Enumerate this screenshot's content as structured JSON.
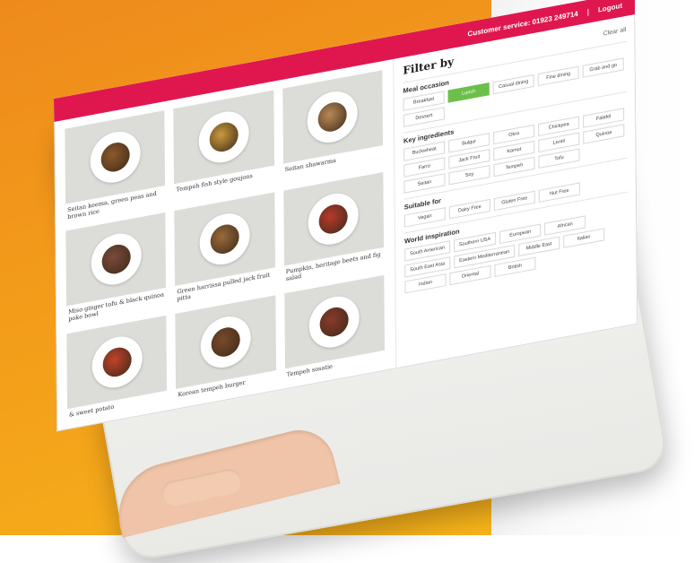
{
  "topbar": {
    "customer_service": "Customer service: 01923 249714",
    "separator": "|",
    "logout": "Logout"
  },
  "dishes": [
    {
      "caption": "Seitan keema, green peas and brown rice",
      "accent": "#8c5a2a"
    },
    {
      "caption": "Tempeh fish style goujons",
      "accent": "#c99a3c"
    },
    {
      "caption": "Seitan shawarma",
      "accent": "#b98a56"
    },
    {
      "caption": "Miso ginger tofu & black quinoa poke bowl",
      "accent": "#7a4a3a"
    },
    {
      "caption": "Green harrissa pulled jack fruit pitta",
      "accent": "#9a6a3a"
    },
    {
      "caption": "Pumpkin, heritage beets and fig salad",
      "accent": "#b8392a"
    },
    {
      "caption": "& sweet potato",
      "accent": "#c2422a"
    },
    {
      "caption": "Korean tempeh burger",
      "accent": "#7a4a2a"
    },
    {
      "caption": "Tempeh sosatie",
      "accent": "#8a3a2a"
    }
  ],
  "filters": {
    "title": "Filter by",
    "clear_all": "Clear all",
    "meal_occasion": {
      "title": "Meal occasion",
      "options": [
        "Breakfast",
        "Lunch",
        "Casual dining",
        "Fine dining",
        "Grab and go",
        "Dessert"
      ],
      "active": "Lunch"
    },
    "key_ingredients": {
      "title": "Key ingredients",
      "options": [
        "Buckwheat",
        "Bulgur",
        "Okra",
        "Chickpea",
        "Falafel",
        "Farro",
        "Jack Fruit",
        "Kamut",
        "Lentil",
        "Quinoa",
        "Seitan",
        "Soy",
        "Tempeh",
        "Tofu"
      ]
    },
    "suitable_for": {
      "title": "Suitable for",
      "options": [
        "Vegan",
        "Dairy Free",
        "Gluten Free",
        "Nut Free"
      ]
    },
    "world_inspiration": {
      "title": "World inspiration",
      "options": [
        "South American",
        "Southern USA",
        "European",
        "African",
        "South East Asia",
        "Eastern Mediterranean",
        "Middle East",
        "Italian",
        "Indian",
        "Oriental",
        "British"
      ]
    }
  },
  "colors": {
    "brand_pink": "#e0174f",
    "active_green": "#6cc04a",
    "background_orange": "#f39c1a"
  }
}
